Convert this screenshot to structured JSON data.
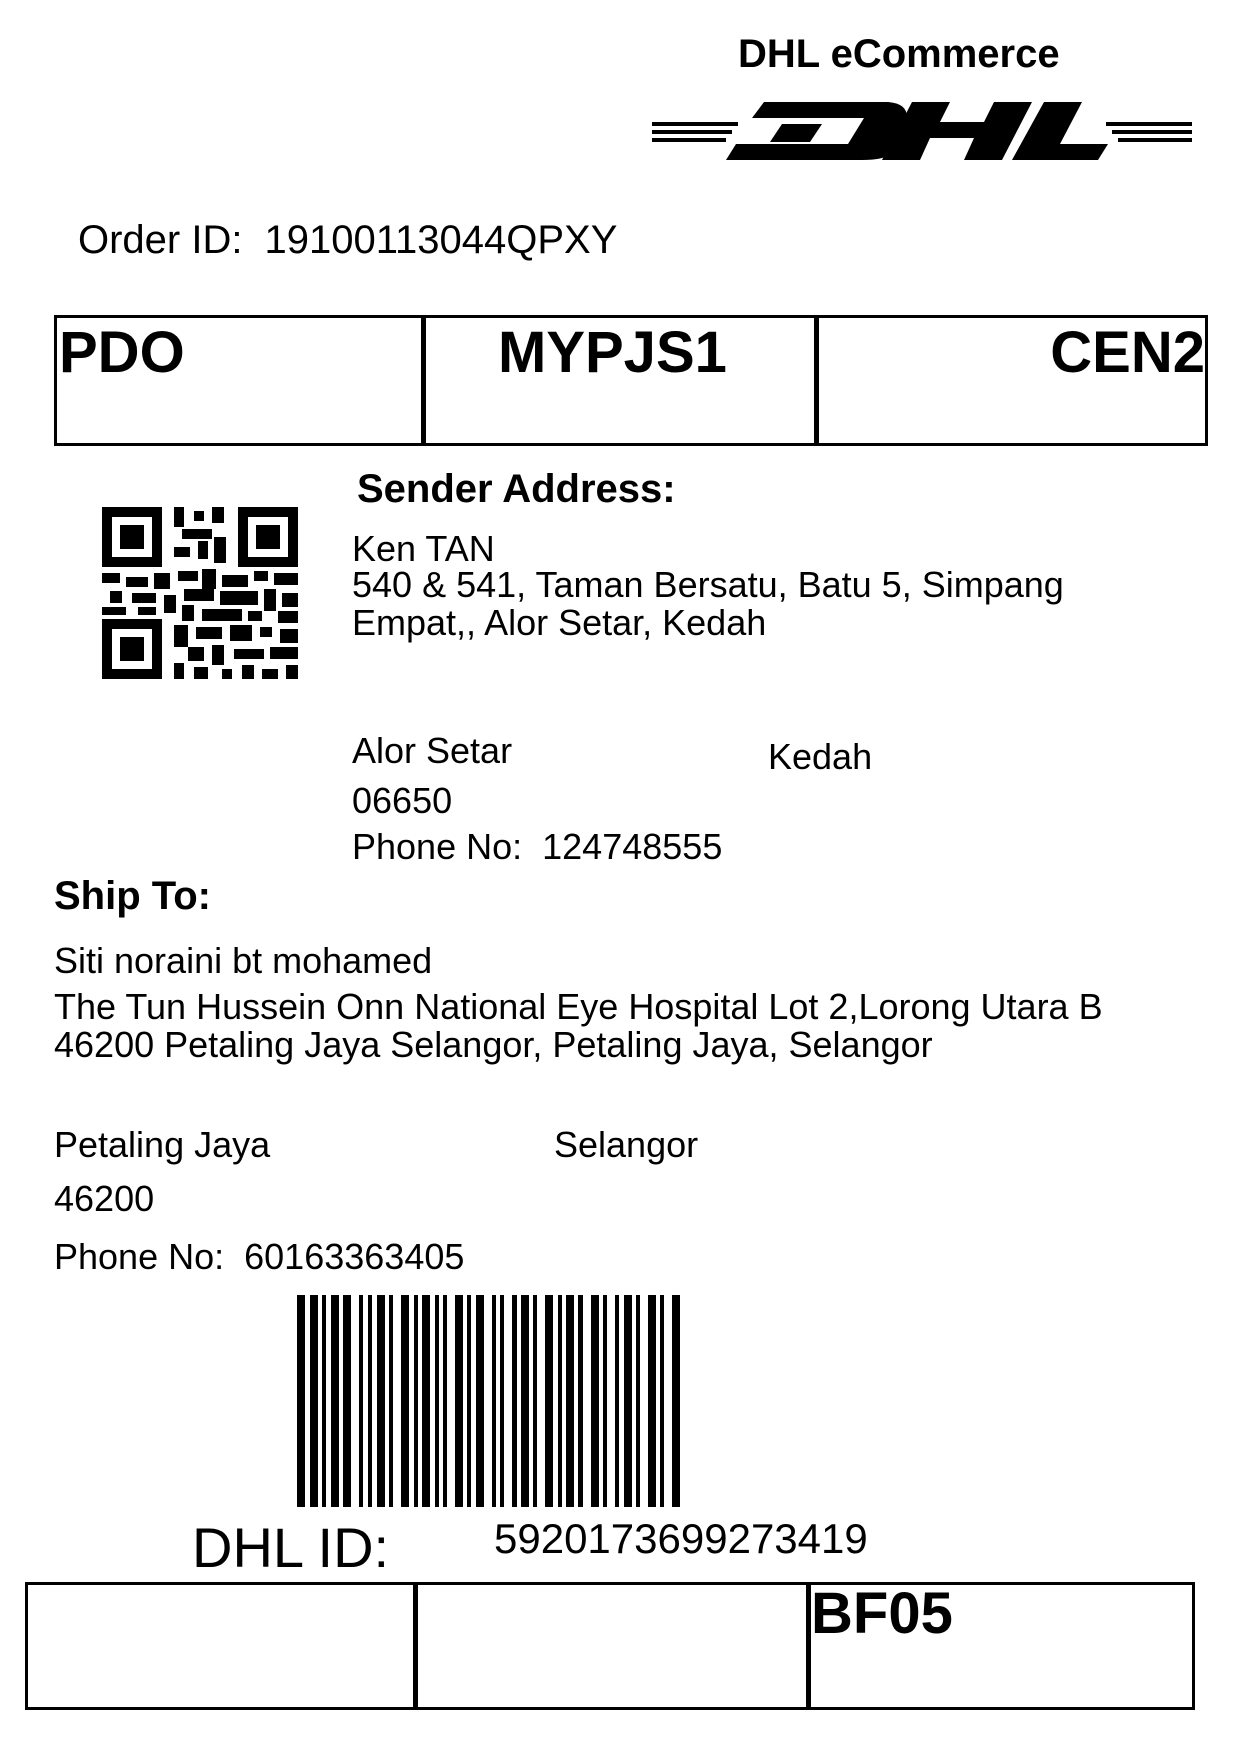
{
  "brand": {
    "title": "DHL eCommerce",
    "logo_text": "DHL",
    "logo_icon": "dhl-logo-icon"
  },
  "order": {
    "label": "Order ID:",
    "value": "19100113044QPXY"
  },
  "routing": {
    "cells": [
      "PDO",
      "MYPJS1",
      "CEN2"
    ]
  },
  "qr_icon": "qr-code-icon",
  "sender": {
    "heading": "Sender Address:",
    "name": "Ken TAN",
    "address": "540 & 541, Taman Bersatu, Batu 5, Simpang Empat,, Alor Setar, Kedah",
    "city": "Alor Setar",
    "state": "Kedah",
    "postcode": "06650",
    "phone_label": "Phone No:",
    "phone": "124748555"
  },
  "recipient": {
    "heading": "Ship To:",
    "name": "Siti noraini bt mohamed",
    "address": "The Tun Hussein Onn National Eye Hospital Lot 2,Lorong Utara B 46200 Petaling Jaya Selangor, Petaling Jaya, Selangor",
    "city": "Petaling Jaya",
    "state": "Selangor",
    "postcode": "46200",
    "phone_label": "Phone No:",
    "phone": "60163363405"
  },
  "barcode_icon": "barcode-icon",
  "tracking": {
    "label": "DHL ID:",
    "value": "5920173699273419"
  },
  "footer": {
    "cells": [
      "",
      "",
      "BF05"
    ]
  }
}
